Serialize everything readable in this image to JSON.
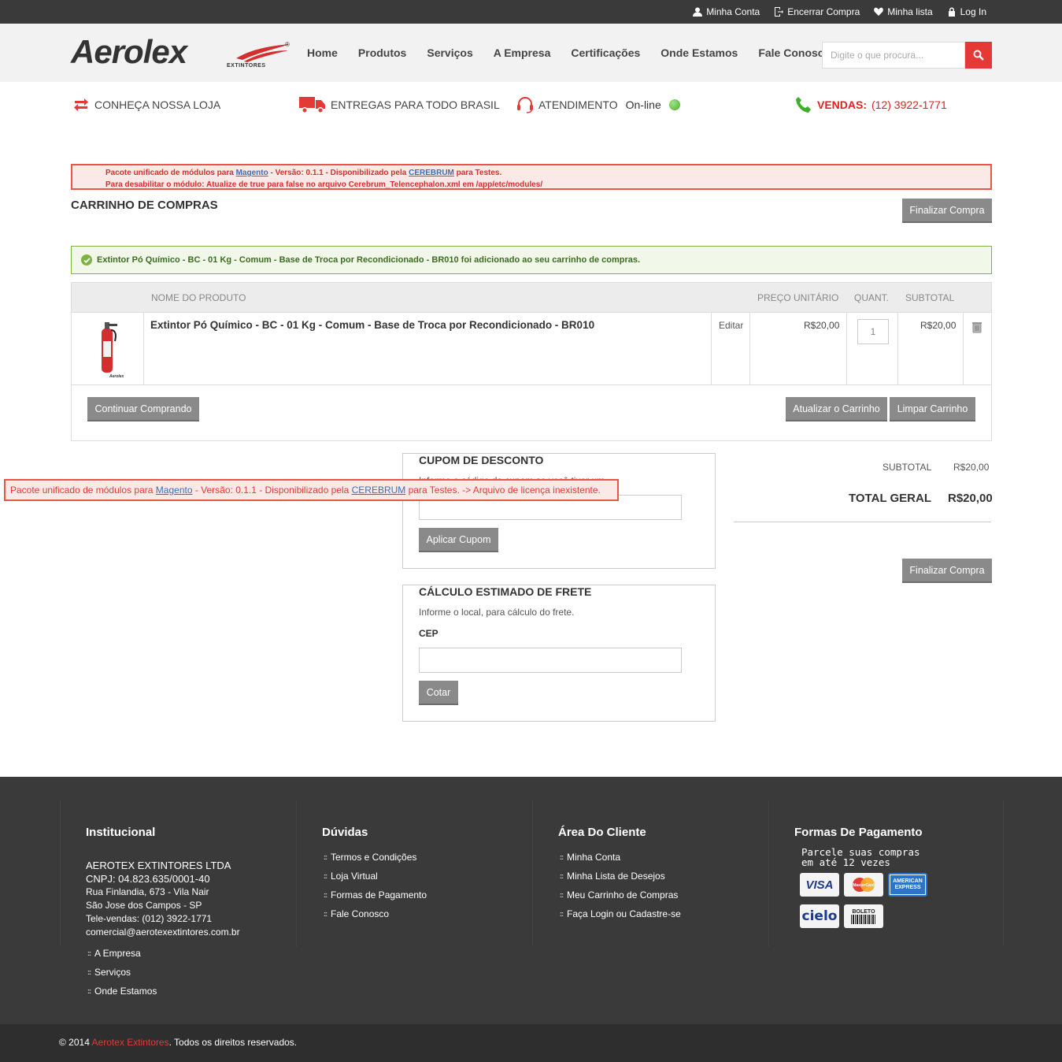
{
  "topbar": {
    "links": [
      {
        "label": "Minha Conta",
        "icon": "user-icon"
      },
      {
        "label": "Encerrar Compra",
        "icon": "checkout-icon"
      },
      {
        "label": "Minha lista",
        "icon": "heart-icon"
      },
      {
        "label": "Log In",
        "icon": "lock-icon"
      }
    ]
  },
  "header": {
    "logo_text": "Aerolex",
    "logo_sub": "EXTINTORES",
    "nav": [
      "Home",
      "Produtos",
      "Serviços",
      "A Empresa",
      "Certificações",
      "Onde Estamos",
      "Fale Conosco"
    ],
    "search_placeholder": "Digite o que procura..."
  },
  "infobar": {
    "loja": "CONHEÇA NOSSA LOJA",
    "entregas": "ENTREGAS PARA TODO BRASIL",
    "atendimento": "ATENDIMENTO",
    "online": "On-line",
    "vendas_label": "VENDAS:",
    "vendas_phone": "(12) 3922-1771"
  },
  "notice_top": {
    "l1_a": "Pacote unificado de módulos para ",
    "l1_link1": "Magento",
    "l1_b": " - Versão: 0.1.1 - Disponibilizado pela ",
    "l1_link2": "CEREBRUM",
    "l1_c": " para Testes.",
    "l2": "Para desabilitar o módulo: Atualize de true para false no arquivo Cerebrum_Telencephalon.xml em /app/etc/modules/"
  },
  "notice_float": {
    "a": "Pacote unificado de módulos para ",
    "link1": "Magento",
    "b": " - Versão: 0.1.1 - Disponibilizado pela ",
    "link2": "CEREBRUM",
    "c": " para Testes. -> Arquivo de licença inexistente."
  },
  "cart": {
    "title": "CARRINHO DE COMPRAS",
    "checkout_label": "Finalizar Compra",
    "success_msg": "Extintor Pó Químico - BC - 01 Kg - Comum - Base de Troca por Recondicionado - BR010 foi adicionado ao seu carrinho de compras.",
    "headers": {
      "name": "NOME DO PRODUTO",
      "unit": "PREÇO UNITÁRIO",
      "qty": "QUANT.",
      "subtotal": "SUBTOTAL"
    },
    "item": {
      "name": "Extintor Pó Químico - BC - 01 Kg - Comum - Base de Troca por Recondicionado - BR010",
      "edit": "Editar",
      "unit_price": "R$20,00",
      "qty": "1",
      "subtotal": "R$20,00",
      "image_caption": "Aerolex"
    },
    "continue_label": "Continuar Comprando",
    "update_label": "Atualizar o Carrinho",
    "clear_label": "Limpar Carrinho"
  },
  "coupon": {
    "title": "CUPOM DE DESCONTO",
    "text": "Informe o código do cupom se você tiver um.",
    "apply_label": "Aplicar Cupom"
  },
  "shipping": {
    "title": "CÁLCULO ESTIMADO DE FRETE",
    "text": "Informe o local, para cálculo do frete.",
    "cep_label": "CEP",
    "quote_label": "Cotar"
  },
  "totals": {
    "subtotal_label": "SUBTOTAL",
    "subtotal_value": "R$20,00",
    "total_label": "TOTAL GERAL",
    "total_value": "R$20,00",
    "checkout_label": "Finalizar Compra"
  },
  "footer": {
    "institucional": {
      "title": "Institucional",
      "company": "AEROTEX EXTINTORES LTDA",
      "cnpj": "CNPJ: 04.823.635/0001-40",
      "address": "Rua Finlandia, 673 - Vila Nair",
      "city": "São Jose dos Campos - SP",
      "phone": "Tele-vendas: (012) 3922-1771",
      "email": "comercial@aerotexextintores.com.br",
      "links": [
        "A Empresa",
        "Serviços",
        "Onde Estamos"
      ]
    },
    "duvidas": {
      "title": "Dúvidas",
      "links": [
        "Termos e Condições",
        "Loja Virtual",
        "Formas de Pagamento",
        "Fale Conosco"
      ]
    },
    "cliente": {
      "title": "Área Do Cliente",
      "links": [
        "Minha Conta",
        "Minha Lista de Desejos",
        "Meu Carrinho de Compras",
        "Faça Login ou Cadastre-se"
      ]
    },
    "pagamento": {
      "title": "Formas De Pagamento",
      "text1": "Parcele suas compras",
      "text2": "em até 12 vezes",
      "cards": [
        "VISA",
        "MasterCard",
        "AMERICAN EXPRESS",
        "cielo",
        "BOLETO"
      ]
    },
    "copyright_a": "© 2014 ",
    "copyright_brand": "Aerotex Extintores",
    "copyright_b": ". Todos os direitos reservados."
  }
}
